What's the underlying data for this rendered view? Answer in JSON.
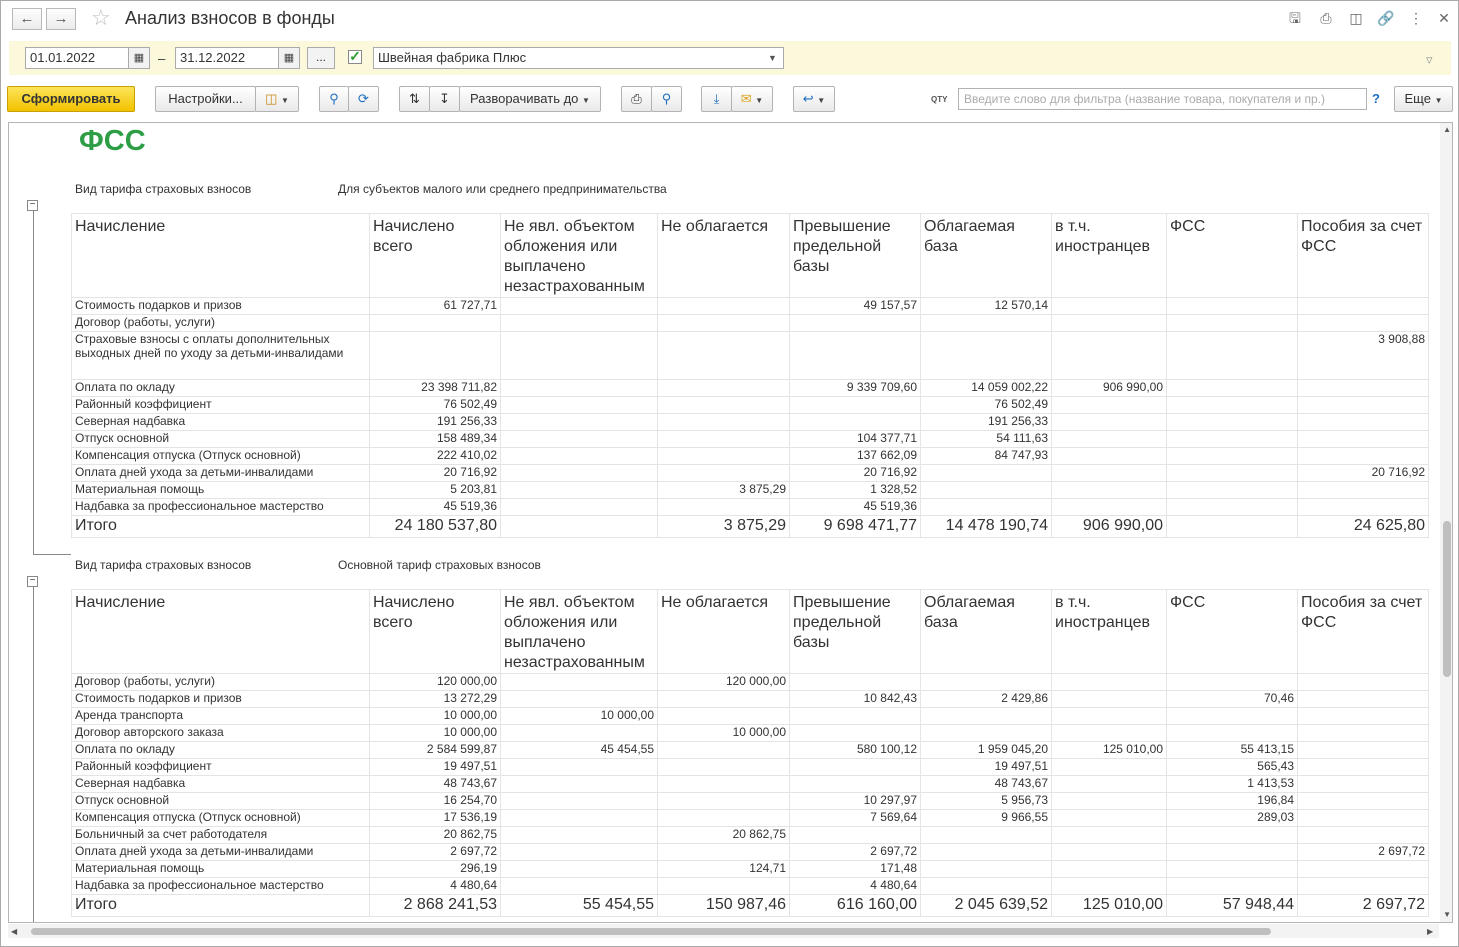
{
  "window": {
    "title": "Анализ взносов в фонды",
    "back_icon": "arrow-left",
    "forward_icon": "arrow-right",
    "star_icon": "star"
  },
  "filter": {
    "date_from": "01.01.2022",
    "date_separator": "–",
    "date_to": "31.12.2022",
    "ellipsis": "...",
    "organization_checked": true,
    "organization": "Швейная фабрика Плюс"
  },
  "toolbar": {
    "generate": "Сформировать",
    "settings": "Настройки...",
    "expand_to": "Разворачивать до",
    "more": "Еще",
    "qty_label": "QTY",
    "search_placeholder": "Введите слово для фильтра (название товара, покупателя и пр.)",
    "help": "?"
  },
  "report": {
    "title": "ФСС",
    "header": {
      "c0": "Начисление",
      "c1": "Начислено всего",
      "c2": "Не явл. объектом обложения или выплачено незастрахованным",
      "c3": "Не облагается",
      "c4": "Превышение предельной базы",
      "c5": "Облагаемая база",
      "c6": "в т.ч. иностранцев",
      "c7": "ФСС",
      "c8": "Пособия за счет ФСС"
    },
    "groups": [
      {
        "label": "Вид тарифа страховых взносов",
        "value": "Для субъектов малого или среднего предпринимательства",
        "rows": [
          [
            "Стоимость подарков и призов",
            "61 727,71",
            "",
            "",
            "49 157,57",
            "12 570,14",
            "",
            "",
            ""
          ],
          [
            "Договор (работы, услуги)",
            "",
            "",
            "",
            "",
            "",
            "",
            "",
            ""
          ],
          [
            "Страховые взносы с оплаты дополнительных выходных дней по уходу за детьми-инвалидами",
            "",
            "",
            "",
            "",
            "",
            "",
            "",
            "3 908,88"
          ],
          [
            "Оплата по окладу",
            "23 398 711,82",
            "",
            "",
            "9 339 709,60",
            "14 059 002,22",
            "906 990,00",
            "",
            ""
          ],
          [
            "Районный коэффициент",
            "76 502,49",
            "",
            "",
            "",
            "76 502,49",
            "",
            "",
            ""
          ],
          [
            "Северная надбавка",
            "191 256,33",
            "",
            "",
            "",
            "191 256,33",
            "",
            "",
            ""
          ],
          [
            "Отпуск основной",
            "158 489,34",
            "",
            "",
            "104 377,71",
            "54 111,63",
            "",
            "",
            ""
          ],
          [
            "Компенсация отпуска (Отпуск основной)",
            "222 410,02",
            "",
            "",
            "137 662,09",
            "84 747,93",
            "",
            "",
            ""
          ],
          [
            "Оплата дней ухода за детьми-инвалидами",
            "20 716,92",
            "",
            "",
            "20 716,92",
            "",
            "",
            "",
            "20 716,92"
          ],
          [
            "Материальная помощь",
            "5 203,81",
            "",
            "3 875,29",
            "1 328,52",
            "",
            "",
            "",
            ""
          ],
          [
            "Надбавка за профессиональное мастерство",
            "45 519,36",
            "",
            "",
            "45 519,36",
            "",
            "",
            "",
            ""
          ]
        ],
        "total": [
          "Итого",
          "24 180 537,80",
          "",
          "3 875,29",
          "9 698 471,77",
          "14 478 190,74",
          "906 990,00",
          "",
          "24 625,80"
        ]
      },
      {
        "label": "Вид тарифа страховых взносов",
        "value": "Основной тариф страховых взносов",
        "rows": [
          [
            "Договор (работы, услуги)",
            "120 000,00",
            "",
            "120 000,00",
            "",
            "",
            "",
            "",
            ""
          ],
          [
            "Стоимость подарков и призов",
            "13 272,29",
            "",
            "",
            "10 842,43",
            "2 429,86",
            "",
            "70,46",
            ""
          ],
          [
            "Аренда транспорта",
            "10 000,00",
            "10 000,00",
            "",
            "",
            "",
            "",
            "",
            ""
          ],
          [
            "Договор авторского заказа",
            "10 000,00",
            "",
            "10 000,00",
            "",
            "",
            "",
            "",
            ""
          ],
          [
            "Оплата по окладу",
            "2 584 599,87",
            "45 454,55",
            "",
            "580 100,12",
            "1 959 045,20",
            "125 010,00",
            "55 413,15",
            ""
          ],
          [
            "Районный коэффициент",
            "19 497,51",
            "",
            "",
            "",
            "19 497,51",
            "",
            "565,43",
            ""
          ],
          [
            "Северная надбавка",
            "48 743,67",
            "",
            "",
            "",
            "48 743,67",
            "",
            "1 413,53",
            ""
          ],
          [
            "Отпуск основной",
            "16 254,70",
            "",
            "",
            "10 297,97",
            "5 956,73",
            "",
            "196,84",
            ""
          ],
          [
            "Компенсация отпуска (Отпуск основной)",
            "17 536,19",
            "",
            "",
            "7 569,64",
            "9 966,55",
            "",
            "289,03",
            ""
          ],
          [
            "Больничный за счет работодателя",
            "20 862,75",
            "",
            "20 862,75",
            "",
            "",
            "",
            "",
            ""
          ],
          [
            "Оплата дней ухода за детьми-инвалидами",
            "2 697,72",
            "",
            "",
            "2 697,72",
            "",
            "",
            "",
            "2 697,72"
          ],
          [
            "Материальная помощь",
            "296,19",
            "",
            "124,71",
            "171,48",
            "",
            "",
            "",
            ""
          ],
          [
            "Надбавка за профессиональное мастерство",
            "4 480,64",
            "",
            "",
            "4 480,64",
            "",
            "",
            "",
            ""
          ]
        ],
        "total": [
          "Итого",
          "2 868 241,53",
          "55 454,55",
          "150 987,46",
          "616 160,00",
          "2 045 639,52",
          "125 010,00",
          "57 948,44",
          "2 697,72"
        ]
      }
    ]
  }
}
